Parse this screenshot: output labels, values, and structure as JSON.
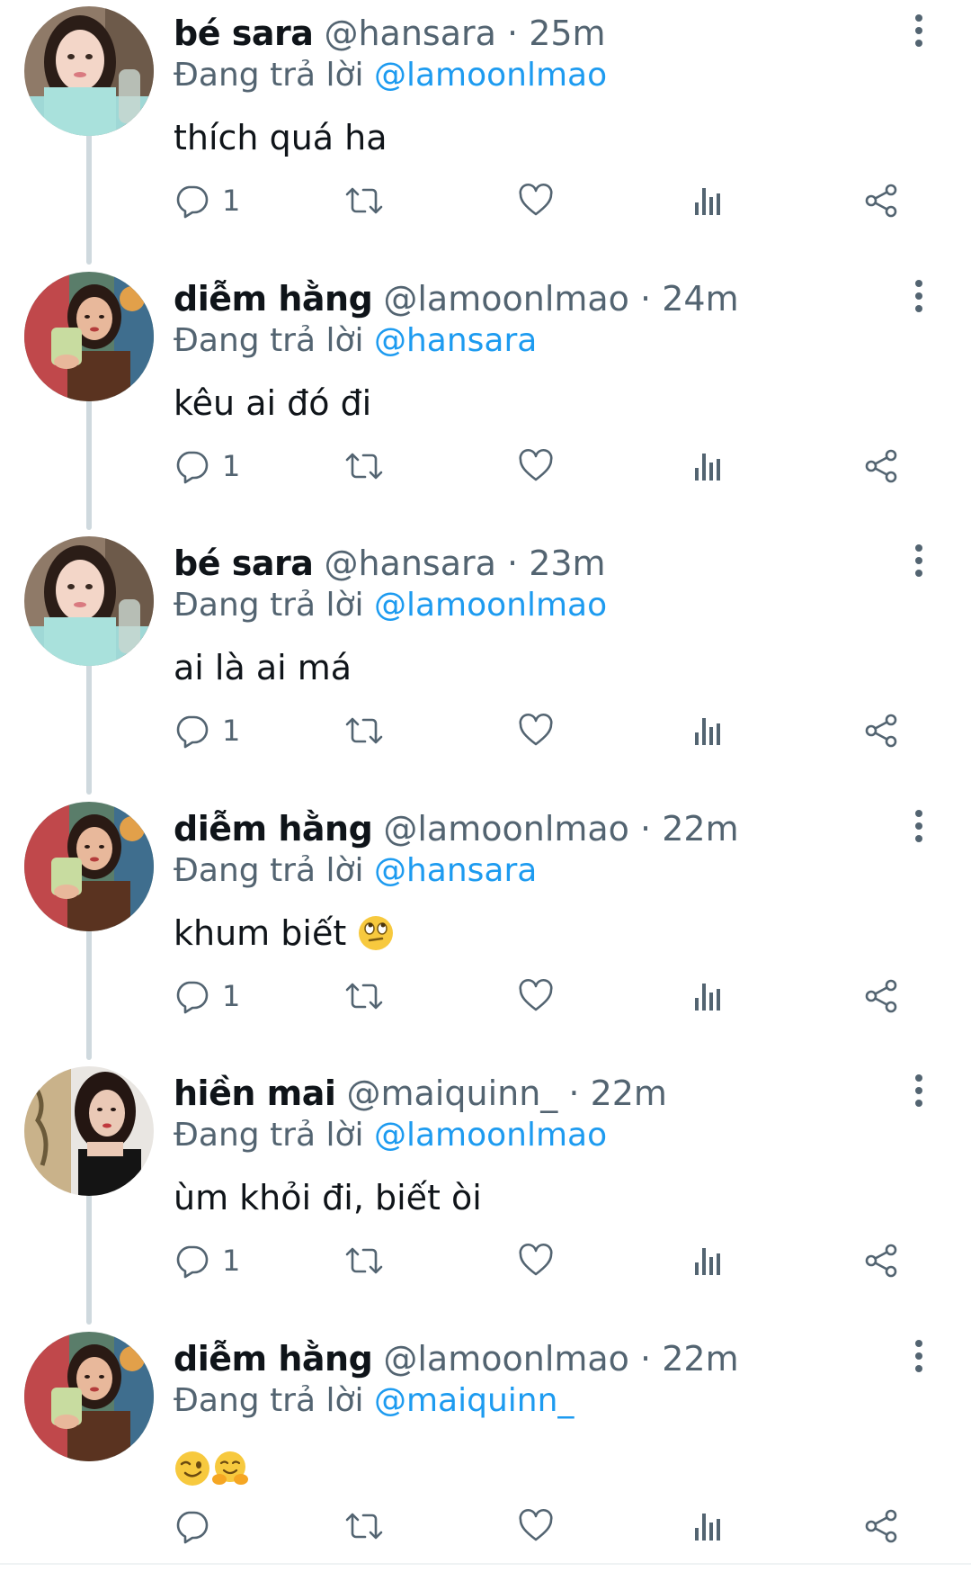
{
  "colors": {
    "text_primary": "#0f1419",
    "text_secondary": "#536471",
    "link": "#1d9bf0",
    "thread_line": "#cfd9de"
  },
  "action_icons": [
    "reply-icon",
    "retweet-icon",
    "like-icon",
    "views-icon",
    "share-icon"
  ],
  "tweets": [
    {
      "name": "bé sara",
      "handle": "@hansara",
      "sep": "·",
      "time": "25m",
      "reply_label": "Đang trả lời",
      "reply_to": "@lamoonlmao",
      "text": "thích quá ha",
      "emojis": [],
      "reply_count": "1",
      "avatar": "avatar-sara"
    },
    {
      "name": "diễm hằng",
      "handle": "@lamoonlmao",
      "sep": "·",
      "time": "24m",
      "reply_label": "Đang trả lời",
      "reply_to": "@hansara",
      "text": "kêu ai đó đi",
      "emojis": [],
      "reply_count": "1",
      "avatar": "avatar-hang"
    },
    {
      "name": "bé sara",
      "handle": "@hansara",
      "sep": "·",
      "time": "23m",
      "reply_label": "Đang trả lời",
      "reply_to": "@lamoonlmao",
      "text": "ai là ai má",
      "emojis": [],
      "reply_count": "1",
      "avatar": "avatar-sara"
    },
    {
      "name": "diễm hằng",
      "handle": "@lamoonlmao",
      "sep": "·",
      "time": "22m",
      "reply_label": "Đang trả lời",
      "reply_to": "@hansara",
      "text": "khum biết",
      "emojis": [
        "eye-roll-emoji"
      ],
      "reply_count": "1",
      "avatar": "avatar-hang"
    },
    {
      "name": "hiền mai",
      "handle": "@maiquinn_",
      "sep": "·",
      "time": "22m",
      "reply_label": "Đang trả lời",
      "reply_to": "@lamoonlmao",
      "text": "ùm khỏi đi, biết òi",
      "emojis": [],
      "reply_count": "1",
      "avatar": "avatar-mai"
    },
    {
      "name": "diễm hằng",
      "handle": "@lamoonlmao",
      "sep": "·",
      "time": "22m",
      "reply_label": "Đang trả lời",
      "reply_to": "@maiquinn_",
      "text": "",
      "emojis": [
        "wink-emoji",
        "hugging-emoji"
      ],
      "reply_count": "",
      "avatar": "avatar-hang"
    }
  ]
}
